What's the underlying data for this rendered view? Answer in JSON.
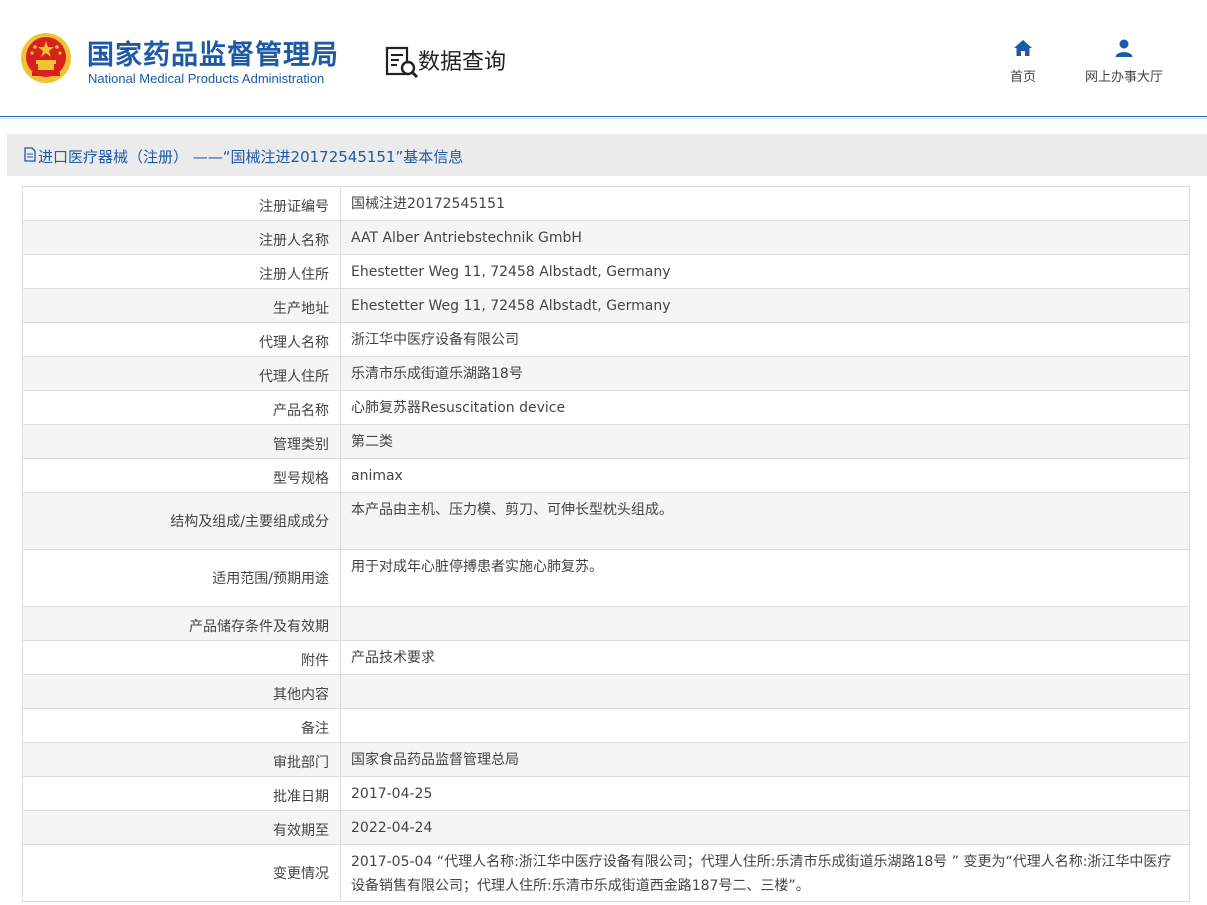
{
  "header": {
    "title_cn": "国家药品监督管理局",
    "title_en": "National Medical Products Administration",
    "query_label": "数据查询",
    "nav": [
      {
        "label": "首页",
        "icon": "home-icon"
      },
      {
        "label": "网上办事大厅",
        "icon": "user-icon"
      }
    ]
  },
  "panel": {
    "title": "进口医疗器械（注册） ——“国械注进20172545151”基本信息"
  },
  "rows": [
    {
      "key": "注册证编号",
      "value": "国械注进20172545151"
    },
    {
      "key": "注册人名称",
      "value": "AAT Alber Antriebstechnik GmbH"
    },
    {
      "key": "注册人住所",
      "value": "Ehestetter Weg 11, 72458 Albstadt, Germany"
    },
    {
      "key": "生产地址",
      "value": "Ehestetter Weg 11, 72458 Albstadt, Germany"
    },
    {
      "key": "代理人名称",
      "value": "浙江华中医疗设备有限公司"
    },
    {
      "key": "代理人住所",
      "value": "乐清市乐成街道乐湖路18号"
    },
    {
      "key": "产品名称",
      "value": "心肺复苏器Resuscitation device"
    },
    {
      "key": "管理类别",
      "value": "第二类"
    },
    {
      "key": "型号规格",
      "value": "animax"
    },
    {
      "key": "结构及组成/主要组成成分",
      "value": "本产品由主机、压力模、剪刀、可伸长型枕头组成。"
    },
    {
      "key": "适用范围/预期用途",
      "value": "用于对成年心脏停搏患者实施心肺复苏。"
    },
    {
      "key": "产品储存条件及有效期",
      "value": ""
    },
    {
      "key": "附件",
      "value": "产品技术要求"
    },
    {
      "key": "其他内容",
      "value": ""
    },
    {
      "key": "备注",
      "value": ""
    },
    {
      "key": "审批部门",
      "value": "国家食品药品监督管理总局"
    },
    {
      "key": "批准日期",
      "value": "2017-04-25"
    },
    {
      "key": "有效期至",
      "value": "2022-04-24"
    },
    {
      "key": "变更情况",
      "value": "2017-05-04 “代理人名称:浙江华中医疗设备有限公司；代理人住所:乐清市乐成街道乐湖路18号 ” 变更为“代理人名称:浙江华中医疗设备销售有限公司；代理人住所:乐清市乐成街道西金路187号二、三楼”。"
    }
  ],
  "colors": {
    "brand_blue": "#1c5aa8",
    "emblem_red": "#d8201f",
    "emblem_gold": "#f1c232"
  }
}
